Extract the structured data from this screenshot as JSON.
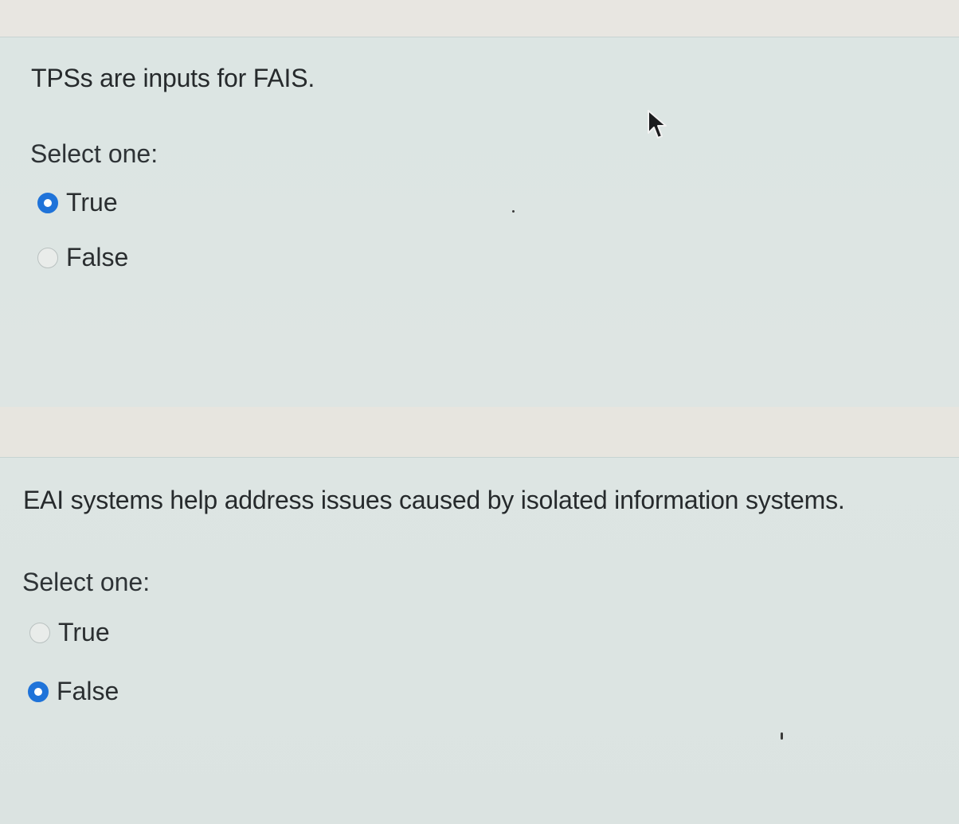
{
  "questions": [
    {
      "text": "TPSs are inputs for FAIS.",
      "prompt": "Select one:",
      "options": [
        {
          "label": "True",
          "selected": true
        },
        {
          "label": "False",
          "selected": false
        }
      ]
    },
    {
      "text": "EAI systems help address issues caused by isolated information systems.",
      "prompt": "Select one:",
      "options": [
        {
          "label": "True",
          "selected": false
        },
        {
          "label": "False",
          "selected": true
        }
      ]
    }
  ],
  "colors": {
    "radio_selected": "#1f73d9",
    "question_background": "#dfe6e4"
  },
  "icons": [
    "mouse-pointer-icon"
  ]
}
